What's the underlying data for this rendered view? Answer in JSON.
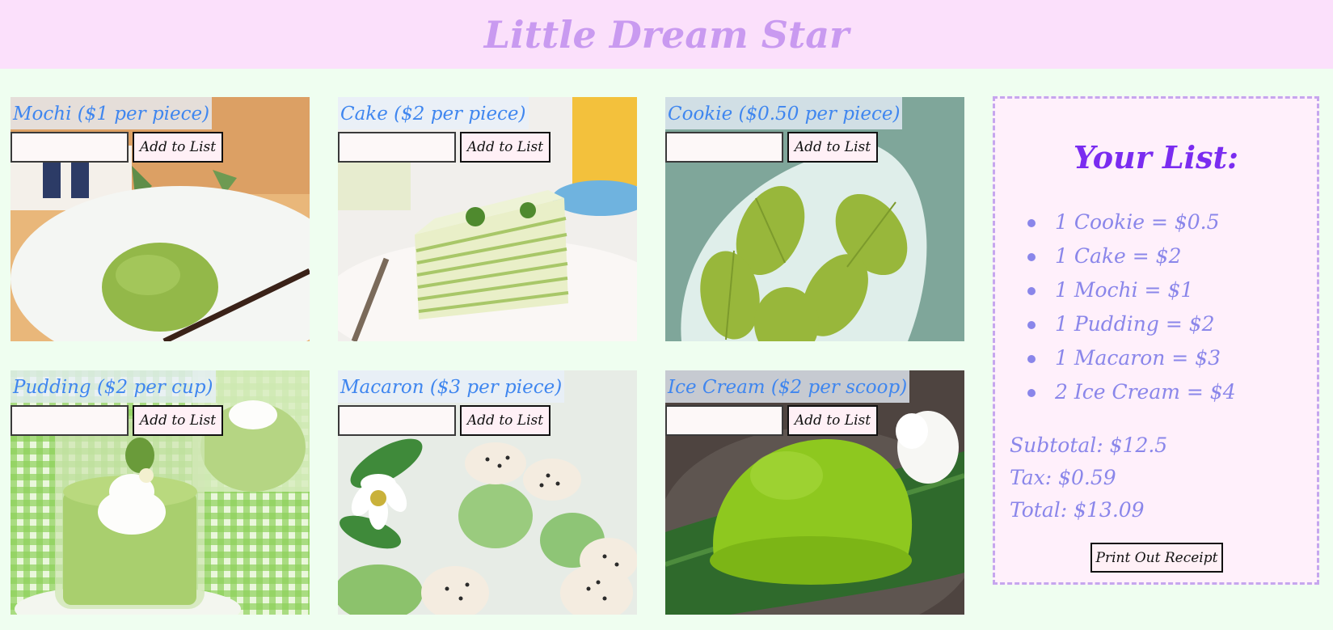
{
  "header": {
    "title": "Little Dream Star"
  },
  "products": [
    {
      "label": "Mochi ($1 per piece)",
      "button": "Add to List",
      "qty": "",
      "icon": "mochi-photo"
    },
    {
      "label": "Cake ($2 per piece)",
      "button": "Add to List",
      "qty": "",
      "icon": "cake-photo"
    },
    {
      "label": "Cookie ($0.50 per piece)",
      "button": "Add to List",
      "qty": "",
      "icon": "cookie-photo"
    },
    {
      "label": "Pudding ($2 per cup)",
      "button": "Add to List",
      "qty": "",
      "icon": "pudding-photo"
    },
    {
      "label": "Macaron ($3 per piece)",
      "button": "Add to List",
      "qty": "",
      "icon": "macaron-photo"
    },
    {
      "label": "Ice Cream ($2 per scoop)",
      "button": "Add to List",
      "qty": "",
      "icon": "ice-cream-photo"
    }
  ],
  "list": {
    "title": "Your List:",
    "items": [
      "1 Cookie = $0.5",
      "1 Cake = $2",
      "1 Mochi = $1",
      "1 Pudding = $2",
      "1 Macaron = $3",
      "2 Ice Cream = $4"
    ],
    "subtotal": "Subtotal: $12.5",
    "tax": "Tax: $0.59",
    "total": "Total: $13.09",
    "print_button": "Print Out Receipt"
  },
  "colors": {
    "page_bg": "#effef0",
    "header_bg": "#fbe0fb",
    "title": "#c99af0",
    "label": "#3f86ef",
    "list_title": "#7a2cf0",
    "list_text": "#8a86ea",
    "matcha": "#8cc043"
  }
}
